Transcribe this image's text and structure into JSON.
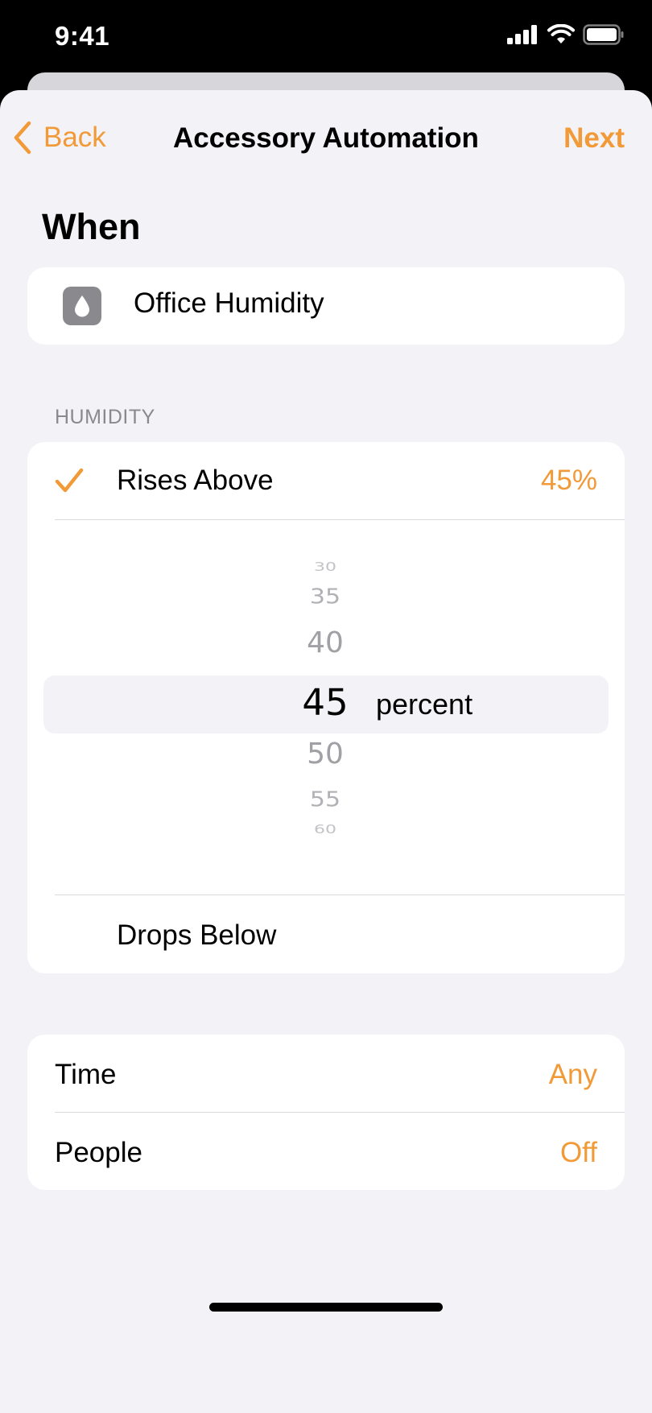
{
  "status_bar": {
    "time": "9:41"
  },
  "nav": {
    "back_label": "Back",
    "title": "Accessory Automation",
    "next_label": "Next"
  },
  "when": {
    "heading": "When",
    "accessory": {
      "name": "Office Humidity",
      "icon": "humidity-drop-icon"
    }
  },
  "humidity": {
    "section_label": "HUMIDITY",
    "rises_above": {
      "label": "Rises Above",
      "value": "45%",
      "selected": true
    },
    "picker": {
      "values": [
        "30",
        "35",
        "40",
        "45",
        "50",
        "55",
        "60"
      ],
      "selected": "45",
      "unit": "percent"
    },
    "drops_below": {
      "label": "Drops Below"
    }
  },
  "options": {
    "time": {
      "label": "Time",
      "value": "Any"
    },
    "people": {
      "label": "People",
      "value": "Off"
    }
  },
  "colors": {
    "accent": "#f19a37",
    "background": "#f2f2f7",
    "card": "#ffffff",
    "secondary_text": "#8a8a8e"
  }
}
